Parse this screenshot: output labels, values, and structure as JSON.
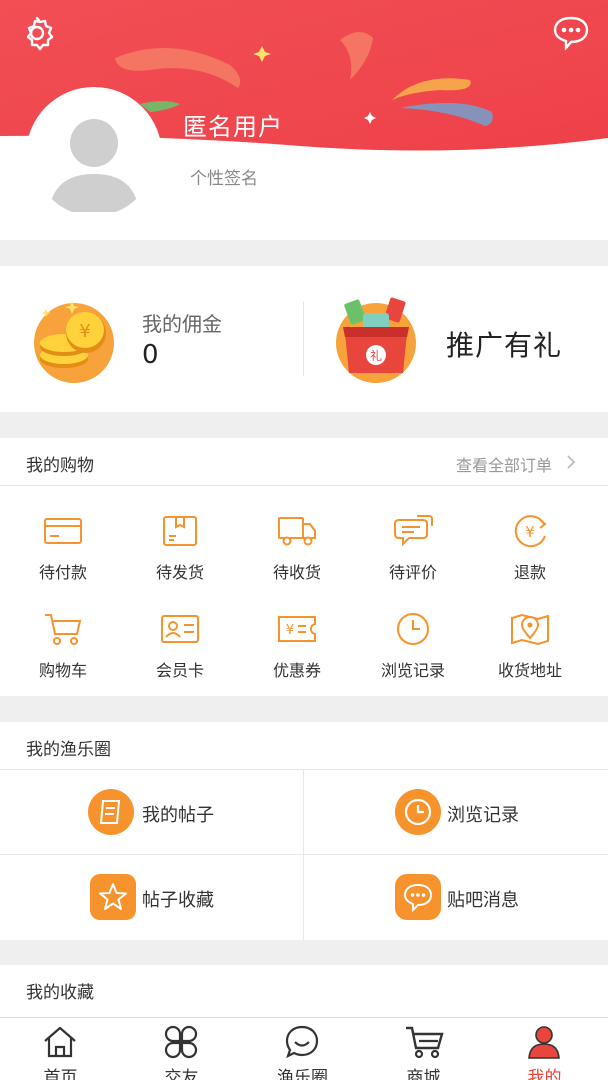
{
  "profile": {
    "username": "匿名用户",
    "signature": "个性签名"
  },
  "commission": {
    "label": "我的佣金",
    "value": "0",
    "promo_label": "推广有礼"
  },
  "shopping": {
    "title": "我的购物",
    "view_all": "查看全部订单",
    "items": [
      {
        "label": "待付款",
        "icon": "card-icon"
      },
      {
        "label": "待发货",
        "icon": "package-icon"
      },
      {
        "label": "待收货",
        "icon": "truck-icon"
      },
      {
        "label": "待评价",
        "icon": "comment-icon"
      },
      {
        "label": "退款",
        "icon": "refund-icon"
      },
      {
        "label": "购物车",
        "icon": "cart-icon"
      },
      {
        "label": "会员卡",
        "icon": "member-card-icon"
      },
      {
        "label": "优惠券",
        "icon": "coupon-icon"
      },
      {
        "label": "浏览记录",
        "icon": "clock-icon"
      },
      {
        "label": "收货地址",
        "icon": "map-pin-icon"
      }
    ]
  },
  "circle": {
    "title": "我的渔乐圈",
    "items": [
      {
        "label": "我的帖子",
        "icon": "post-icon"
      },
      {
        "label": "浏览记录",
        "icon": "clock-icon"
      },
      {
        "label": "帖子收藏",
        "icon": "star-icon"
      },
      {
        "label": "贴吧消息",
        "icon": "message-icon"
      }
    ]
  },
  "favorites": {
    "title": "我的收藏"
  },
  "tabbar": {
    "tabs": [
      {
        "label": "首页",
        "icon": "home-icon"
      },
      {
        "label": "交友",
        "icon": "clover-icon"
      },
      {
        "label": "渔乐圈",
        "icon": "chat-bubble-icon"
      },
      {
        "label": "商城",
        "icon": "cart-icon"
      },
      {
        "label": "我的",
        "icon": "person-icon"
      }
    ],
    "active_index": 4
  },
  "colors": {
    "header_red": "#f04a50",
    "accent_orange": "#f6932d",
    "active_tab": "#e8453c"
  }
}
